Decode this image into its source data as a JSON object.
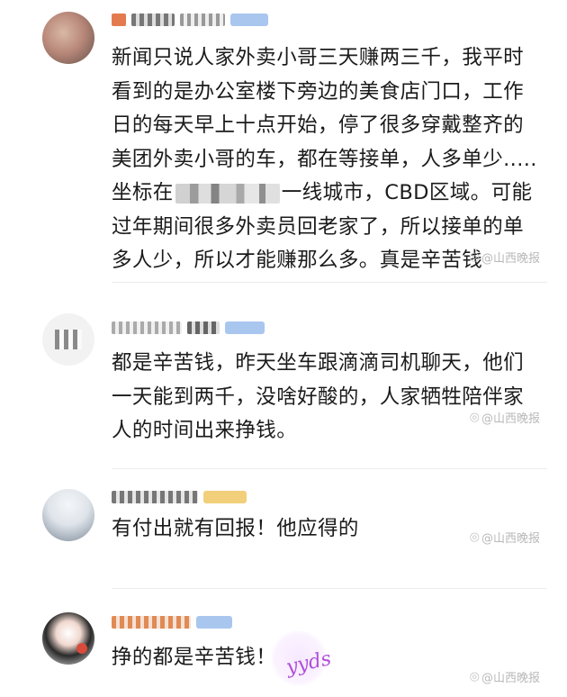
{
  "comments": [
    {
      "text_before": "新闻只说人家外卖小哥三天赚两三千，我平时看到的是办公室楼下旁边的美食店门口，工作日的每天早上十点开始，停了很多穿戴整齐的美团外卖小哥的车，都在等接单，人多单少.....坐标在",
      "text_after": "一线城市，CBD区域。可能过年期间很多外卖员回老家了，所以接单的单多人少，所以才能赚那么多。真是辛苦钱",
      "watermark": "@山西晚报"
    },
    {
      "text": "都是辛苦钱，昨天坐车跟滴滴司机聊天，他们一天能到两千，没啥好酸的，人家牺牲陪伴家人的时间出来挣钱。",
      "watermark": "@山西晚报"
    },
    {
      "text": "有付出就有回报！他应得的",
      "watermark": "@山西晚报"
    },
    {
      "text": "挣的都是辛苦钱！",
      "watermark": "@山西晚报",
      "sticker_text": "yyds"
    }
  ],
  "colors": {
    "badge_blue": "#a9c6ef",
    "badge_gold": "#f2cf7a",
    "watermark": "#b9b9b9",
    "divider": "#ececec"
  },
  "icons": {
    "watermark_icon": "weibo-logo-icon"
  }
}
